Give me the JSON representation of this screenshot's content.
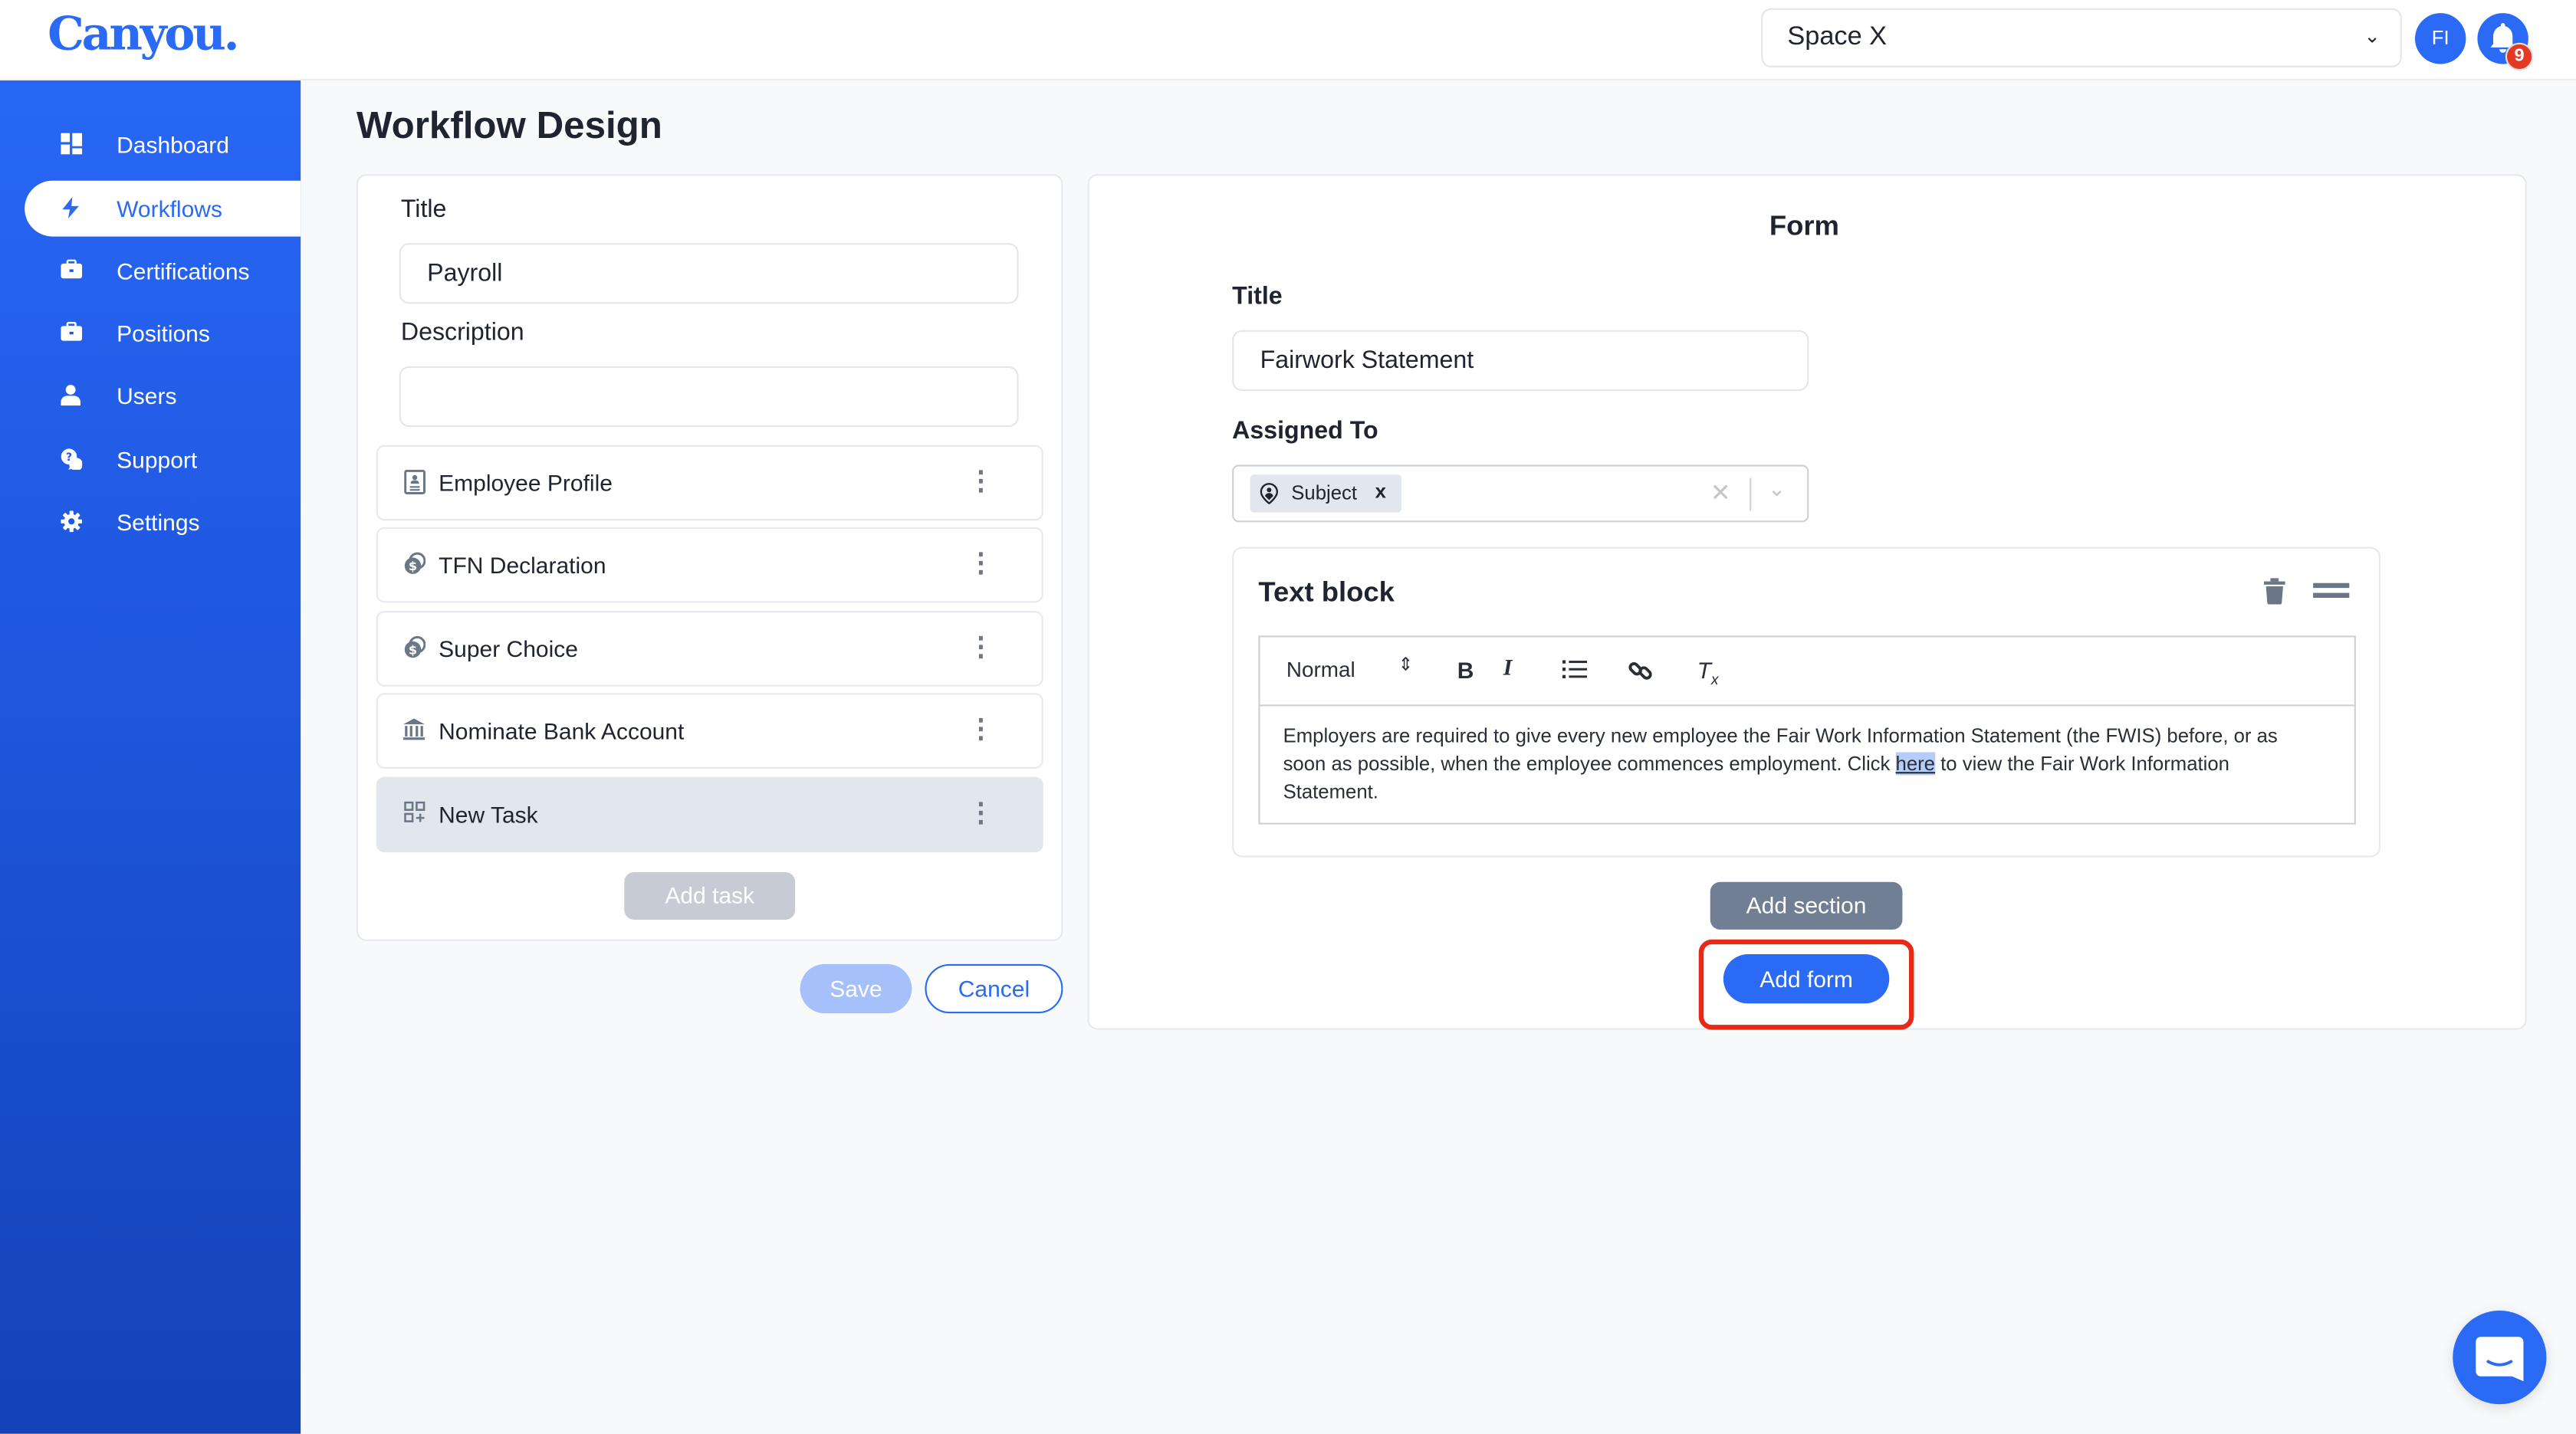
{
  "header": {
    "logo": "Canyou.",
    "space_select": {
      "value": "Space X"
    },
    "avatar_initials": "FI",
    "notification_count": "9"
  },
  "sidebar": {
    "items": [
      {
        "label": "Dashboard",
        "icon": "dashboard-icon",
        "active": false
      },
      {
        "label": "Workflows",
        "icon": "lightning-icon",
        "active": true
      },
      {
        "label": "Certifications",
        "icon": "briefcase-icon",
        "active": false
      },
      {
        "label": "Positions",
        "icon": "briefcase-icon",
        "active": false
      },
      {
        "label": "Users",
        "icon": "user-icon",
        "active": false
      },
      {
        "label": "Support",
        "icon": "support-chat-icon",
        "active": false
      },
      {
        "label": "Settings",
        "icon": "gear-icon",
        "active": false
      }
    ]
  },
  "page": {
    "title": "Workflow Design"
  },
  "workflow": {
    "title_label": "Title",
    "title_value": "Payroll",
    "description_label": "Description",
    "description_value": "",
    "tasks": [
      {
        "label": "Employee Profile",
        "icon": "profile-card-icon",
        "selected": false
      },
      {
        "label": "TFN Declaration",
        "icon": "coins-icon",
        "selected": false
      },
      {
        "label": "Super Choice",
        "icon": "coins-icon",
        "selected": false
      },
      {
        "label": "Nominate Bank Account",
        "icon": "bank-icon",
        "selected": false
      },
      {
        "label": "New Task",
        "icon": "add-grid-icon",
        "selected": true
      }
    ],
    "add_task_label": "Add task",
    "save_label": "Save",
    "cancel_label": "Cancel"
  },
  "form": {
    "heading": "Form",
    "title_label": "Title",
    "title_value": "Fairwork Statement",
    "assigned_label": "Assigned To",
    "assigned_chips": [
      "Subject"
    ],
    "text_block": {
      "title": "Text block",
      "format_select": "Normal",
      "text_before": "Employers are required to give every new employee the Fair Work Information Statement (the FWIS) before, or as soon as possible, when the employee commences employment. Click ",
      "link_text": "here",
      "text_after": " to view the Fair Work Information Statement."
    },
    "add_section_label": "Add section",
    "add_form_label": "Add form"
  },
  "colors": {
    "brand": "#2a6af5",
    "highlight": "#e62a17"
  }
}
